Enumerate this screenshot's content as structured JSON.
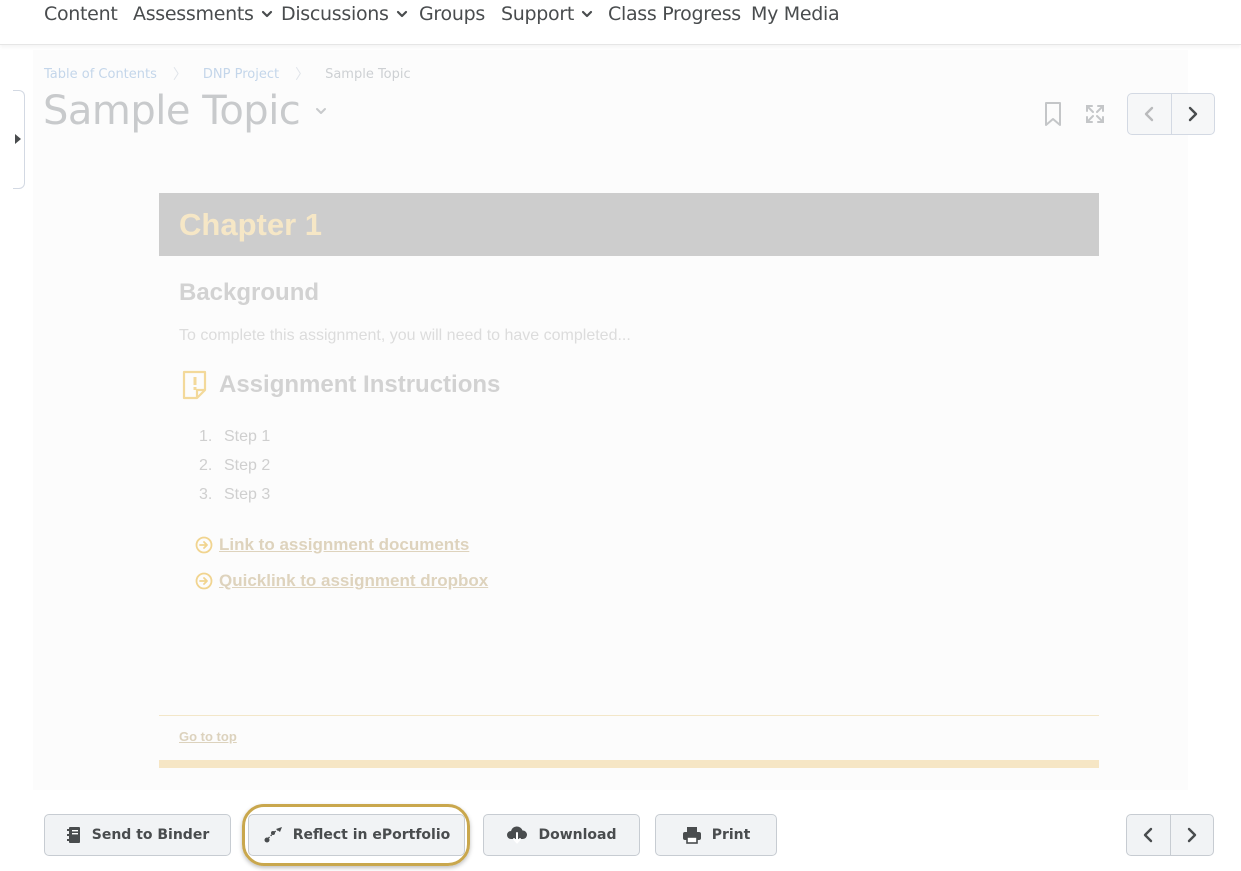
{
  "nav": {
    "items": [
      {
        "label": "Content",
        "has_dropdown": false
      },
      {
        "label": "Assessments",
        "has_dropdown": true
      },
      {
        "label": "Discussions",
        "has_dropdown": true
      },
      {
        "label": "Groups",
        "has_dropdown": false
      },
      {
        "label": "Support",
        "has_dropdown": true
      },
      {
        "label": "Class Progress",
        "has_dropdown": false
      },
      {
        "label": "My Media",
        "has_dropdown": false
      }
    ]
  },
  "breadcrumb": {
    "items": [
      "Table of Contents",
      "DNP Project",
      "Sample Topic"
    ]
  },
  "topic": {
    "title": "Sample Topic",
    "icons": [
      "bookmark-icon",
      "fullscreen-icon"
    ]
  },
  "content": {
    "chapter_title": "Chapter 1",
    "background_heading": "Background",
    "intro_text": "To complete this assignment, you will need to have completed...",
    "instructions_heading": "Assignment Instructions",
    "steps": [
      {
        "num": "1.",
        "text": "Step 1"
      },
      {
        "num": "2.",
        "text": "Step 2"
      },
      {
        "num": "3.",
        "text": "Step 3"
      }
    ],
    "links": [
      "Link to assignment documents",
      "Quicklink to assignment dropbox"
    ],
    "go_to_top": "Go to top"
  },
  "actions": {
    "send_to_binder": "Send to Binder",
    "reflect": "Reflect in ePortfolio",
    "download": "Download",
    "print": "Print"
  },
  "colors": {
    "chapter_bar": "#cdcdcd",
    "chapter_text": "#f6e7c6",
    "highlight": "#c9a74d",
    "button_bg": "#f1f3f5"
  }
}
